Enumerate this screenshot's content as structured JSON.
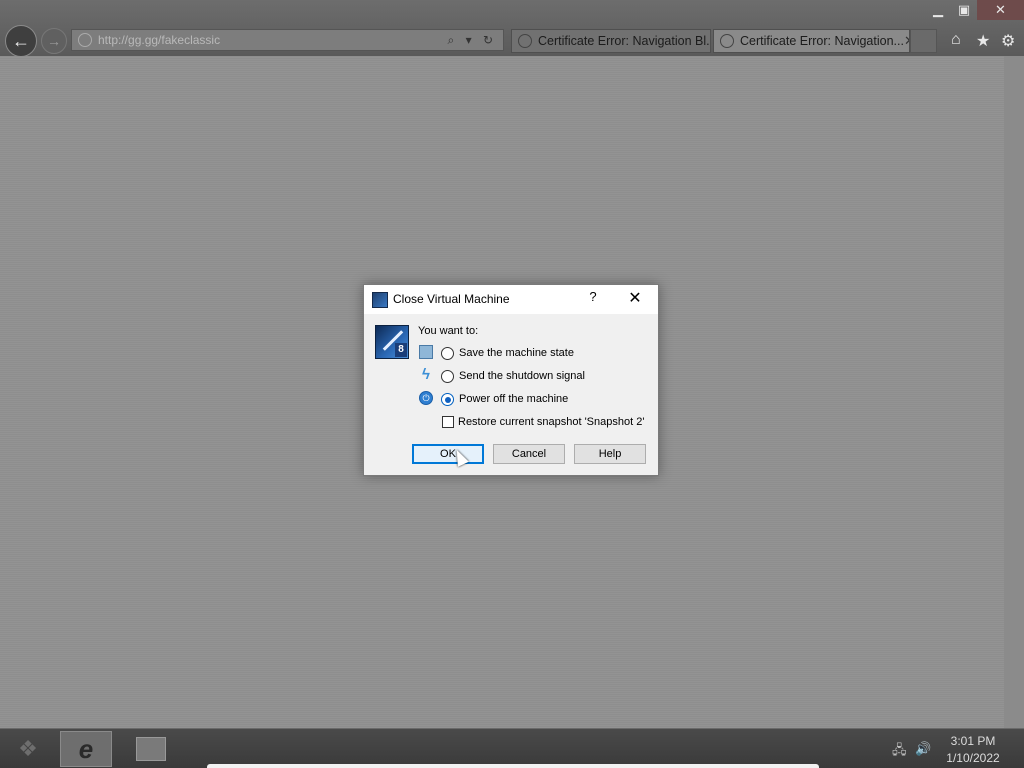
{
  "browser": {
    "address": "http://gg.gg/fakeclassic",
    "tabs": [
      {
        "label": "Certificate Error: Navigation Bl..."
      },
      {
        "label": "Certificate Error: Navigation...",
        "close": "✕"
      }
    ],
    "window_controls": {
      "minimize": "▁",
      "maximize": "▣",
      "close": "✕"
    },
    "nav": {
      "back": "←",
      "forward": "→"
    },
    "address_icons": "⌕ ▾ ↻",
    "toolbar_icons": {
      "home": "⌂",
      "favorites": "★",
      "tools": "⚙"
    }
  },
  "dialog": {
    "title": "Close Virtual Machine",
    "help_glyph": "?",
    "close_glyph": "✕",
    "prompt": "You want to:",
    "options": [
      {
        "label": "Save the machine state",
        "selected": false
      },
      {
        "label": "Send the shutdown signal",
        "selected": false
      },
      {
        "label": "Power off the machine",
        "selected": true
      }
    ],
    "checkbox": {
      "label": "Restore current snapshot 'Snapshot 2'",
      "checked": false
    },
    "badge": "8",
    "buttons": {
      "ok": "OK",
      "cancel": "Cancel",
      "help": "Help"
    }
  },
  "taskbar": {
    "start_glyph": "❖",
    "ie_glyph": "e",
    "tray": {
      "network": "🖧",
      "volume": "🔊"
    },
    "time": "3:01 PM",
    "date": "1/10/2022"
  },
  "colors": {
    "dialog_bg": "#f0f0f0",
    "accent": "#0078d7",
    "chrome": "#5a5a5a"
  }
}
